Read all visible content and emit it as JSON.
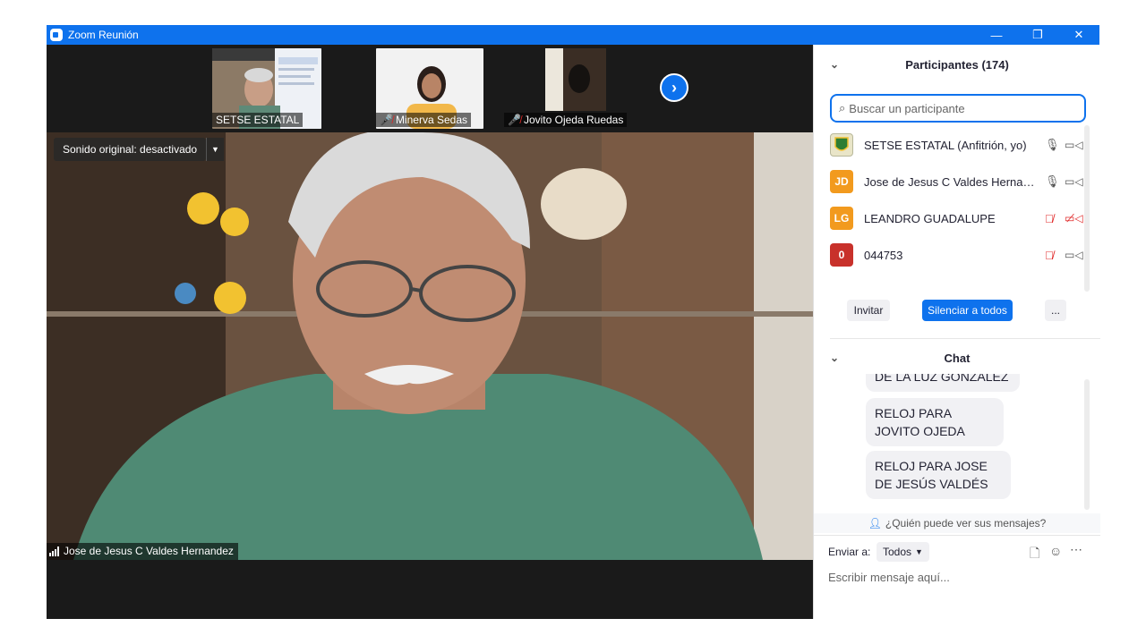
{
  "window": {
    "title": "Zoom Reunión",
    "controls": [
      "—",
      "❐",
      "✕"
    ]
  },
  "thumbnails": [
    {
      "name": "SETSE ESTATAL",
      "muted": false
    },
    {
      "name": "Minerva Sedas",
      "muted": true
    },
    {
      "name": "Jovito Ojeda Ruedas",
      "muted": true
    }
  ],
  "main_video": {
    "sound_label": "Sonido original: desactivado",
    "speaker_name": "Jose de Jesus C Valdes Hernandez"
  },
  "participants": {
    "header": "Participantes (174)",
    "search_placeholder": "Buscar un participante",
    "items": [
      {
        "initials": "",
        "name": "SETSE ESTATAL (Anfitrión, yo)",
        "color": "#e9e5c8",
        "mic_muted": false,
        "cam_off": false
      },
      {
        "initials": "JD",
        "name": "Jose de Jesus C Valdes Hernandez",
        "color": "#f29a1e",
        "mic_muted": false,
        "cam_off": false
      },
      {
        "initials": "LG",
        "name": "LEANDRO GUADALUPE",
        "color": "#f29a1e",
        "mic_muted": true,
        "cam_off": true
      },
      {
        "initials": "0",
        "name": "044753",
        "color": "#c8312b",
        "mic_muted": true,
        "cam_off": false
      }
    ],
    "invite_label": "Invitar",
    "mute_all_label": "Silenciar a todos",
    "more_label": "..."
  },
  "chat": {
    "header": "Chat",
    "messages": [
      "DE LA LUZ GONZÁLEZ",
      "RELOJ PARA JOVITO OJEDA",
      "RELOJ PARA JOSE DE JESÚS VALDÉS"
    ],
    "who_sees": "¿Quién puede ver sus mensajes?",
    "send_to_label": "Enviar a:",
    "send_to_value": "Todos",
    "input_placeholder": "Escribir mensaje aquí..."
  }
}
